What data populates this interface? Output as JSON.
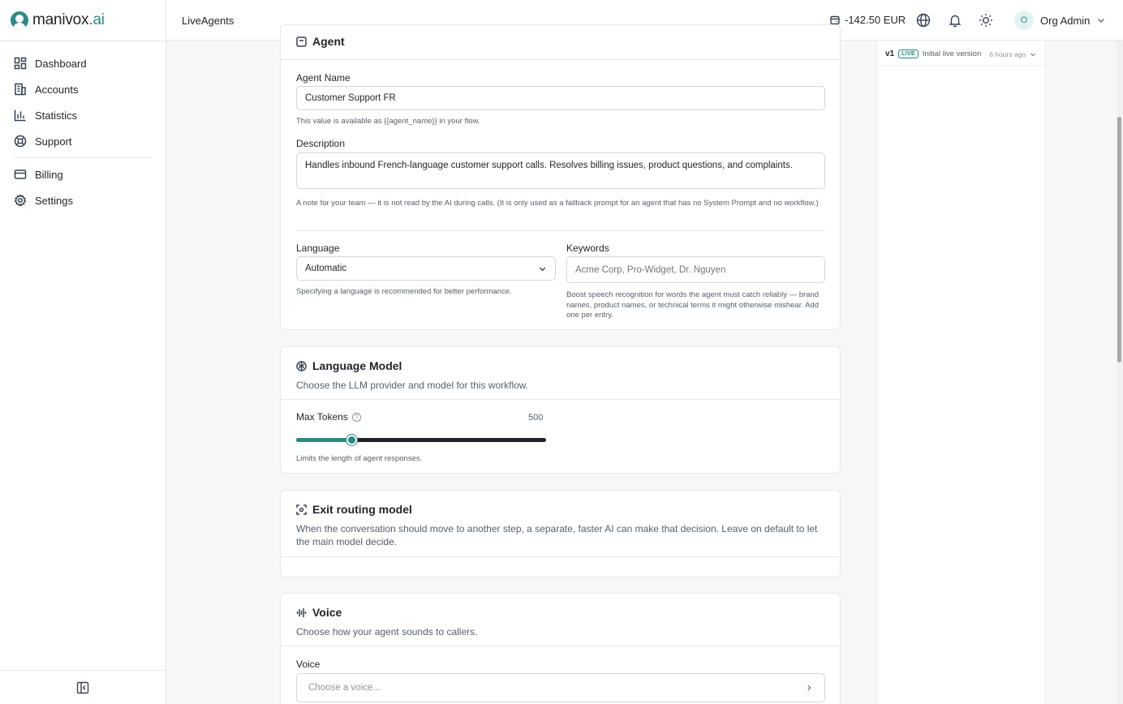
{
  "app": {
    "logo_main": "manivox",
    "logo_accent": ".ai"
  },
  "sidebar": {
    "items": [
      {
        "label": "Dashboard",
        "icon": "dashboard-icon"
      },
      {
        "label": "Accounts",
        "icon": "building-icon"
      },
      {
        "label": "Statistics",
        "icon": "bar-chart-icon"
      },
      {
        "label": "Support",
        "icon": "lifebuoy-icon"
      },
      {
        "label": "Billing",
        "icon": "credit-card-icon"
      },
      {
        "label": "Settings",
        "icon": "gear-icon"
      }
    ]
  },
  "header": {
    "title": "LiveAgents",
    "balance": "-142.50 EUR",
    "user_initial": "O",
    "user_name": "Org Admin"
  },
  "agent_card": {
    "title": "Agent",
    "name_label": "Agent Name",
    "name_value": "Customer Support FR",
    "name_hint": "This value is available as {{agent_name}} in your flow.",
    "description_label": "Description",
    "description_value": "Handles inbound French-language customer support calls. Resolves billing issues, product questions, and complaints.",
    "description_hint": "A note for your team — it is not read by the AI during calls. (It is only used as a fallback prompt for an agent that has no System Prompt and no workflow.)",
    "language_label": "Language",
    "language_value": "Automatic",
    "language_hint": "Specifying a language is recommended for better performance.",
    "keywords_label": "Keywords",
    "keywords_placeholder": "Acme Corp, Pro-Widget, Dr. Nguyen",
    "keywords_hint": "Boost speech recognition for words the agent must catch reliably — brand names, product names, or technical terms it might otherwise mishear. Add one per entry."
  },
  "llm_card": {
    "title": "Language Model",
    "subtitle": "Choose the LLM provider and model for this workflow.",
    "max_tokens_label": "Max Tokens",
    "max_tokens_value": "500",
    "max_tokens_fraction": 0.22,
    "max_tokens_hint": "Limits the length of agent responses."
  },
  "exit_card": {
    "title": "Exit routing model",
    "subtitle": "When the conversation should move to another step, a separate, faster AI can make that decision. Leave on default to let the main model decide."
  },
  "voice_card": {
    "title": "Voice",
    "subtitle": "Choose how your agent sounds to callers.",
    "voice_label": "Voice",
    "voice_placeholder": "Choose a voice..."
  },
  "versions": {
    "version": "v1",
    "badge": "LIVE",
    "label": "Initial live version",
    "time": "6 hours ago"
  },
  "colors": {
    "accent": "#2b8a86",
    "text": "#1f2328",
    "muted": "#57606a",
    "border": "#e5e7eb"
  }
}
